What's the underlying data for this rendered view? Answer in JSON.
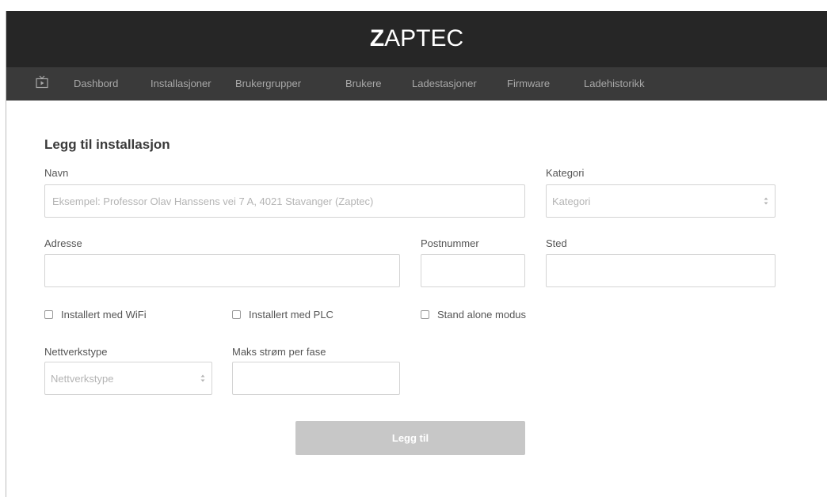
{
  "header": {
    "logo_prefix": "Z",
    "logo_rest": "APTEC"
  },
  "nav": {
    "items": [
      {
        "label": "Dashbord"
      },
      {
        "label": "Installasjoner"
      },
      {
        "label": "Brukergrupper"
      },
      {
        "label": "Brukere"
      },
      {
        "label": "Ladestasjoner"
      },
      {
        "label": "Firmware"
      },
      {
        "label": "Ladehistorikk"
      }
    ]
  },
  "form": {
    "title": "Legg til installasjon",
    "name_label": "Navn",
    "name_placeholder": "Eksempel: Professor Olav Hanssens vei 7 A, 4021 Stavanger (Zaptec)",
    "category_label": "Kategori",
    "category_selected": "Kategori",
    "address_label": "Adresse",
    "postal_label": "Postnummer",
    "city_label": "Sted",
    "wifi_label": "Installert med WiFi",
    "plc_label": "Installert med PLC",
    "standalone_label": "Stand alone modus",
    "network_label": "Nettverkstype",
    "network_selected": "Nettverkstype",
    "max_current_label": "Maks strøm per fase",
    "submit_label": "Legg til"
  },
  "colors": {
    "header_bg": "#262626",
    "nav_bg": "#3a3a3a",
    "nav_text": "#a9a9a9",
    "button_disabled": "#c7c7c7"
  }
}
